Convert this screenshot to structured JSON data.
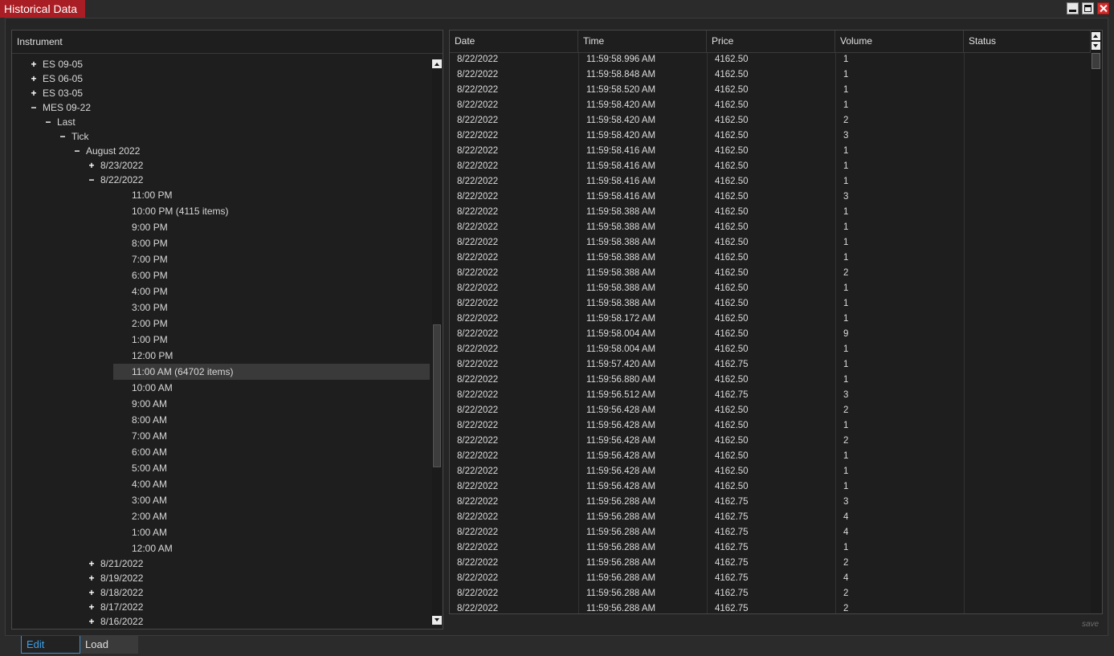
{
  "window": {
    "title": "Historical Data"
  },
  "tree": {
    "header": "Instrument",
    "nodes": [
      {
        "toggle": "+",
        "label": "ES 09-05"
      },
      {
        "toggle": "+",
        "label": "ES 06-05"
      },
      {
        "toggle": "+",
        "label": "ES 03-05"
      },
      {
        "toggle": "−",
        "label": "MES 09-22"
      },
      {
        "toggle": "−",
        "label": "Last"
      },
      {
        "toggle": "−",
        "label": "Tick"
      },
      {
        "toggle": "−",
        "label": "August 2022"
      },
      {
        "toggle": "+",
        "label": "8/23/2022"
      },
      {
        "toggle": "−",
        "label": "8/22/2022"
      },
      {
        "toggle": "",
        "label": "11:00 PM"
      },
      {
        "toggle": "",
        "label": "10:00 PM (4115 items)"
      },
      {
        "toggle": "",
        "label": "9:00 PM"
      },
      {
        "toggle": "",
        "label": "8:00 PM"
      },
      {
        "toggle": "",
        "label": "7:00 PM"
      },
      {
        "toggle": "",
        "label": "6:00 PM"
      },
      {
        "toggle": "",
        "label": "4:00 PM"
      },
      {
        "toggle": "",
        "label": "3:00 PM"
      },
      {
        "toggle": "",
        "label": "2:00 PM"
      },
      {
        "toggle": "",
        "label": "1:00 PM"
      },
      {
        "toggle": "",
        "label": "12:00 PM"
      },
      {
        "toggle": "",
        "label": "11:00 AM (64702 items)",
        "selected": true
      },
      {
        "toggle": "",
        "label": "10:00 AM"
      },
      {
        "toggle": "",
        "label": "9:00 AM"
      },
      {
        "toggle": "",
        "label": "8:00 AM"
      },
      {
        "toggle": "",
        "label": "7:00 AM"
      },
      {
        "toggle": "",
        "label": "6:00 AM"
      },
      {
        "toggle": "",
        "label": "5:00 AM"
      },
      {
        "toggle": "",
        "label": "4:00 AM"
      },
      {
        "toggle": "",
        "label": "3:00 AM"
      },
      {
        "toggle": "",
        "label": "2:00 AM"
      },
      {
        "toggle": "",
        "label": "1:00 AM"
      },
      {
        "toggle": "",
        "label": "12:00 AM"
      },
      {
        "toggle": "+",
        "label": "8/21/2022"
      },
      {
        "toggle": "+",
        "label": "8/19/2022"
      },
      {
        "toggle": "+",
        "label": "8/18/2022"
      },
      {
        "toggle": "+",
        "label": "8/17/2022"
      },
      {
        "toggle": "+",
        "label": "8/16/2022"
      }
    ]
  },
  "grid": {
    "columns": [
      "Date",
      "Time",
      "Price",
      "Volume",
      "Status"
    ],
    "rows": [
      [
        "8/22/2022",
        "11:59:58.996 AM",
        "4162.50",
        "1"
      ],
      [
        "8/22/2022",
        "11:59:58.848 AM",
        "4162.50",
        "1"
      ],
      [
        "8/22/2022",
        "11:59:58.520 AM",
        "4162.50",
        "1"
      ],
      [
        "8/22/2022",
        "11:59:58.420 AM",
        "4162.50",
        "1"
      ],
      [
        "8/22/2022",
        "11:59:58.420 AM",
        "4162.50",
        "2"
      ],
      [
        "8/22/2022",
        "11:59:58.420 AM",
        "4162.50",
        "3"
      ],
      [
        "8/22/2022",
        "11:59:58.416 AM",
        "4162.50",
        "1"
      ],
      [
        "8/22/2022",
        "11:59:58.416 AM",
        "4162.50",
        "1"
      ],
      [
        "8/22/2022",
        "11:59:58.416 AM",
        "4162.50",
        "1"
      ],
      [
        "8/22/2022",
        "11:59:58.416 AM",
        "4162.50",
        "3"
      ],
      [
        "8/22/2022",
        "11:59:58.388 AM",
        "4162.50",
        "1"
      ],
      [
        "8/22/2022",
        "11:59:58.388 AM",
        "4162.50",
        "1"
      ],
      [
        "8/22/2022",
        "11:59:58.388 AM",
        "4162.50",
        "1"
      ],
      [
        "8/22/2022",
        "11:59:58.388 AM",
        "4162.50",
        "1"
      ],
      [
        "8/22/2022",
        "11:59:58.388 AM",
        "4162.50",
        "2"
      ],
      [
        "8/22/2022",
        "11:59:58.388 AM",
        "4162.50",
        "1"
      ],
      [
        "8/22/2022",
        "11:59:58.388 AM",
        "4162.50",
        "1"
      ],
      [
        "8/22/2022",
        "11:59:58.172 AM",
        "4162.50",
        "1"
      ],
      [
        "8/22/2022",
        "11:59:58.004 AM",
        "4162.50",
        "9"
      ],
      [
        "8/22/2022",
        "11:59:58.004 AM",
        "4162.50",
        "1"
      ],
      [
        "8/22/2022",
        "11:59:57.420 AM",
        "4162.75",
        "1"
      ],
      [
        "8/22/2022",
        "11:59:56.880 AM",
        "4162.50",
        "1"
      ],
      [
        "8/22/2022",
        "11:59:56.512 AM",
        "4162.75",
        "3"
      ],
      [
        "8/22/2022",
        "11:59:56.428 AM",
        "4162.50",
        "2"
      ],
      [
        "8/22/2022",
        "11:59:56.428 AM",
        "4162.50",
        "1"
      ],
      [
        "8/22/2022",
        "11:59:56.428 AM",
        "4162.50",
        "2"
      ],
      [
        "8/22/2022",
        "11:59:56.428 AM",
        "4162.50",
        "1"
      ],
      [
        "8/22/2022",
        "11:59:56.428 AM",
        "4162.50",
        "1"
      ],
      [
        "8/22/2022",
        "11:59:56.428 AM",
        "4162.50",
        "1"
      ],
      [
        "8/22/2022",
        "11:59:56.288 AM",
        "4162.75",
        "3"
      ],
      [
        "8/22/2022",
        "11:59:56.288 AM",
        "4162.75",
        "4"
      ],
      [
        "8/22/2022",
        "11:59:56.288 AM",
        "4162.75",
        "4"
      ],
      [
        "8/22/2022",
        "11:59:56.288 AM",
        "4162.75",
        "1"
      ],
      [
        "8/22/2022",
        "11:59:56.288 AM",
        "4162.75",
        "2"
      ],
      [
        "8/22/2022",
        "11:59:56.288 AM",
        "4162.75",
        "4"
      ],
      [
        "8/22/2022",
        "11:59:56.288 AM",
        "4162.75",
        "2"
      ],
      [
        "8/22/2022",
        "11:59:56.288 AM",
        "4162.75",
        "2"
      ]
    ],
    "save_hint": "save"
  },
  "tabs": {
    "edit": "Edit",
    "load": "Load"
  },
  "colors": {
    "title_accent": "#a81e24",
    "selected_tab": "#3ea0e8"
  }
}
